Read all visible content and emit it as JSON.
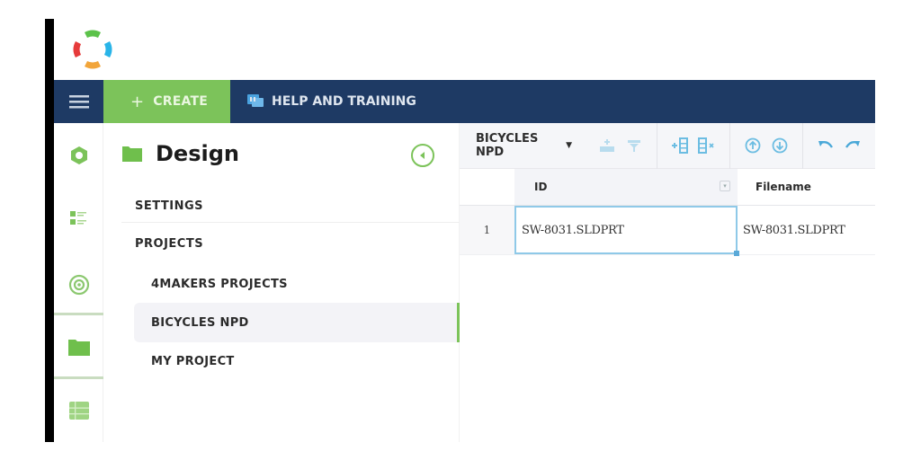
{
  "app": {
    "logo_icon": "multicolor-ring-logo",
    "colors": {
      "navy": "#1e3a64",
      "green": "#7cc35a",
      "logo_green": "#5cc24a",
      "logo_blue": "#29b4e8",
      "logo_orange": "#f2a53a",
      "logo_red": "#e63b3b",
      "toolbar_icon": "#8ccbe6"
    }
  },
  "topbar": {
    "menu_icon": "hamburger-icon",
    "create_label": "CREATE",
    "create_icon": "plus-icon",
    "help_label": "HELP AND TRAINING",
    "help_icon": "chat-help-icon"
  },
  "rail": {
    "items": [
      {
        "icon": "hexagon-icon"
      },
      {
        "icon": "list-icon"
      },
      {
        "icon": "target-icon"
      },
      {
        "icon": "folder-icon",
        "active": true
      },
      {
        "icon": "table-icon"
      }
    ]
  },
  "design_panel": {
    "title": "Design",
    "title_icon": "folder-icon",
    "collapse_icon": "chevron-left-circle-icon",
    "settings_label": "SETTINGS",
    "projects_label": "PROJECTS",
    "projects": [
      {
        "label": "4MAKERS PROJECTS",
        "active": false
      },
      {
        "label": "BICYCLES NPD",
        "active": true
      },
      {
        "label": "MY PROJECT",
        "active": false
      }
    ]
  },
  "grid": {
    "dataset": "BICYCLES NPD",
    "toolbar_icons": [
      "insert-row-icon",
      "filter-icon",
      "add-column-icon",
      "remove-column-icon",
      "move-up-icon",
      "move-down-icon",
      "undo-icon",
      "redo-icon"
    ],
    "columns": [
      {
        "label": "ID"
      },
      {
        "label": "Filename"
      }
    ],
    "rows": [
      {
        "num": "1",
        "cells": [
          "SW-8031.SLDPRT",
          "SW-8031.SLDPRT"
        ]
      }
    ]
  }
}
